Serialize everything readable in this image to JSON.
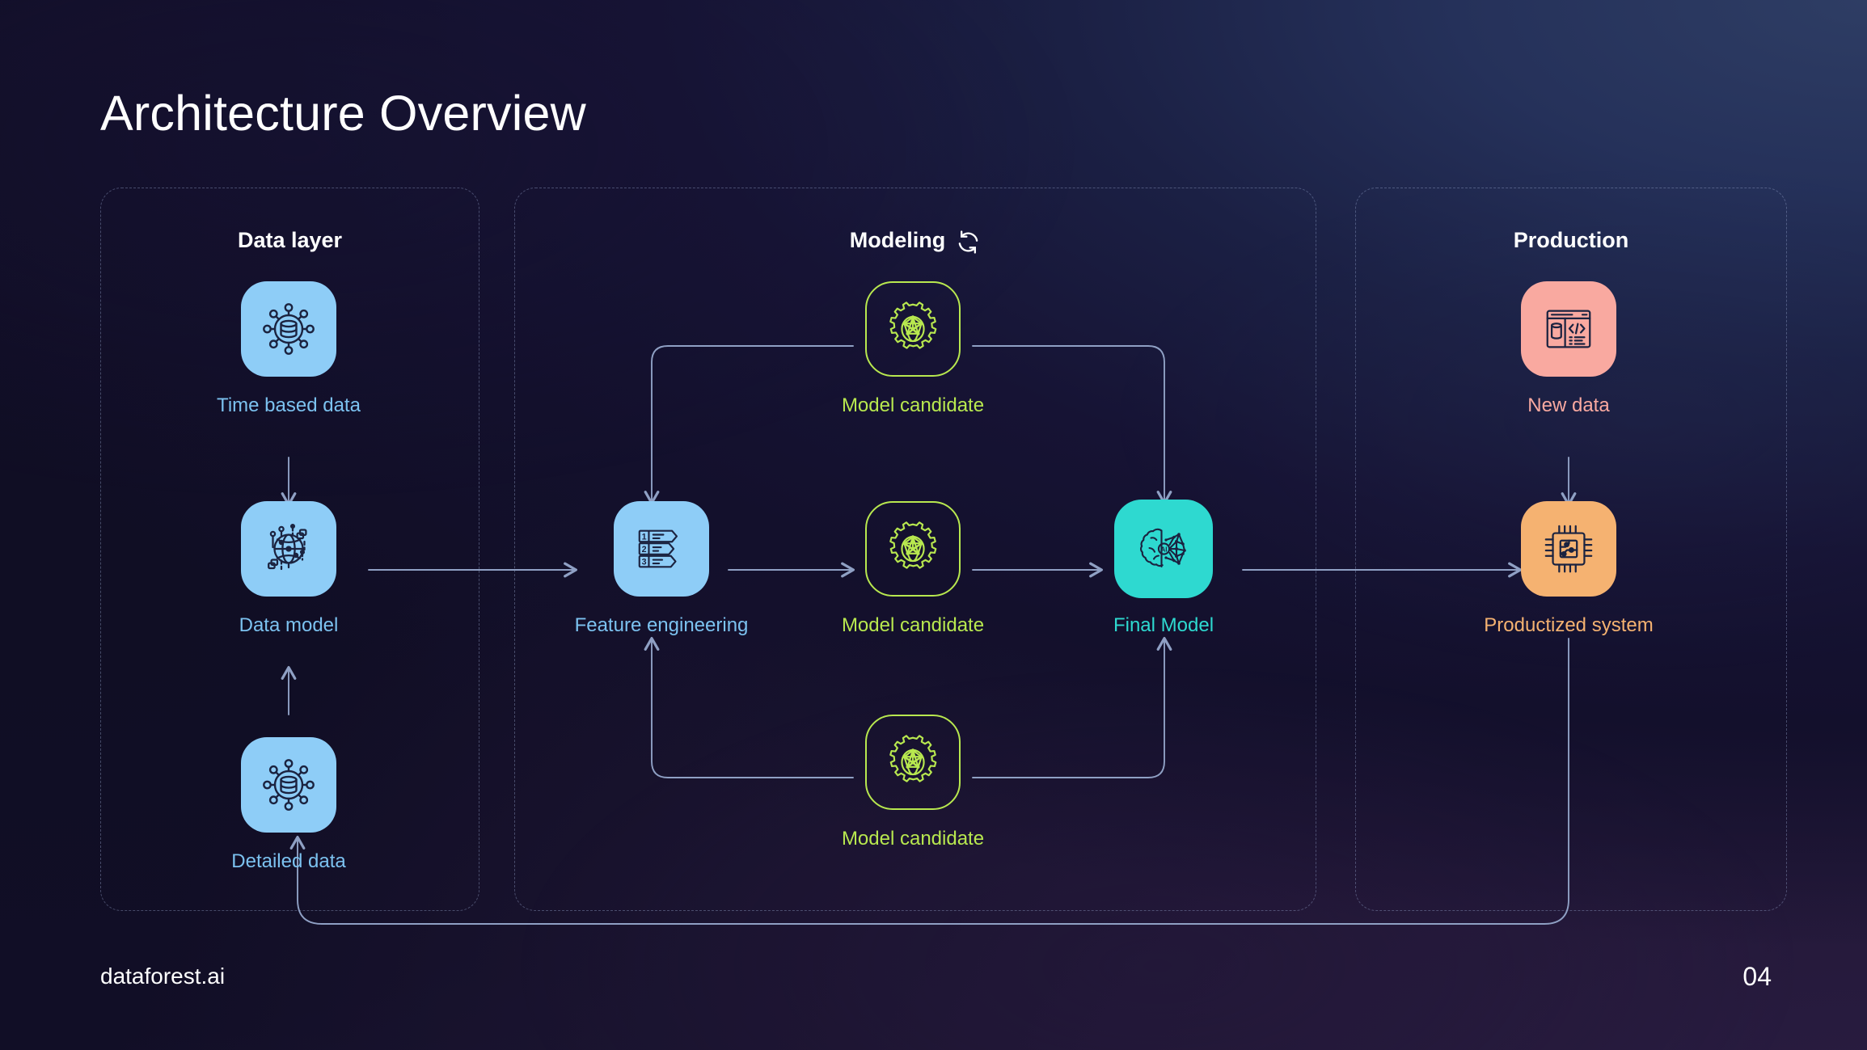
{
  "slide": {
    "title": "Architecture Overview",
    "page_number": "04",
    "brand": "dataforest.ai"
  },
  "colors": {
    "bg_top_right": "#2b3a60",
    "bg_bottom": "#1e1630",
    "bg_left": "#12102a",
    "blue_tile": "#8ecdf7",
    "blue_label": "#7cc2f0",
    "green_outline": "#b8e84f",
    "green_label": "#b8e84f",
    "teal_tile": "#2ed9d0",
    "teal_label": "#2ed9d0",
    "pink_tile": "#f9a9a0",
    "pink_label": "#f9a9a0",
    "orange_tile": "#f5b271",
    "orange_label": "#f5b271",
    "icon_stroke": "#1b2340",
    "connector": "#8fa0c4",
    "panel_border": "#96a6cd",
    "title_text": "#ffffff"
  },
  "panels": [
    {
      "id": "data-layer",
      "title": "Data layer",
      "has_sync_icon": false
    },
    {
      "id": "modeling",
      "title": "Modeling",
      "has_sync_icon": true,
      "sync_icon": "refresh-cycle-icon"
    },
    {
      "id": "production",
      "title": "Production",
      "has_sync_icon": false
    }
  ],
  "nodes": [
    {
      "id": "time-based-data",
      "label": "Time based data",
      "panel": "data-layer",
      "icon": "distributed-database-icon",
      "style": "blue-filled",
      "label_color": "#7cc2f0"
    },
    {
      "id": "data-model",
      "label": "Data model",
      "panel": "data-layer",
      "icon": "globe-network-icon",
      "style": "blue-filled",
      "label_color": "#7cc2f0"
    },
    {
      "id": "detailed-data",
      "label": "Detailed data",
      "panel": "data-layer",
      "icon": "distributed-database-icon",
      "style": "blue-filled",
      "label_color": "#7cc2f0"
    },
    {
      "id": "feature-engineering",
      "label": "Feature engineering",
      "panel": "modeling",
      "icon": "ranked-list-icon",
      "style": "blue-filled",
      "label_color": "#7cc2f0"
    },
    {
      "id": "model-candidate-top",
      "label": "Model candidate",
      "panel": "modeling",
      "icon": "gear-neural-network-icon",
      "style": "green-outline",
      "label_color": "#b8e84f"
    },
    {
      "id": "model-candidate-mid",
      "label": "Model candidate",
      "panel": "modeling",
      "icon": "gear-neural-network-icon",
      "style": "green-outline",
      "label_color": "#b8e84f"
    },
    {
      "id": "model-candidate-bot",
      "label": "Model candidate",
      "panel": "modeling",
      "icon": "gear-neural-network-icon",
      "style": "green-outline",
      "label_color": "#b8e84f"
    },
    {
      "id": "final-model",
      "label": "Final Model",
      "panel": "modeling",
      "icon": "ai-brain-icon",
      "style": "teal-filled",
      "label_color": "#2ed9d0"
    },
    {
      "id": "new-data",
      "label": "New data",
      "panel": "production",
      "icon": "browser-database-code-icon",
      "style": "pink-filled",
      "label_color": "#f9a9a0"
    },
    {
      "id": "productized-system",
      "label": "Productized system",
      "panel": "production",
      "icon": "cpu-chip-icon",
      "style": "orange-filled",
      "label_color": "#f5b271"
    }
  ],
  "connections": [
    {
      "from": "time-based-data",
      "to": "data-model",
      "type": "arrow-down"
    },
    {
      "from": "detailed-data",
      "to": "data-model",
      "type": "arrow-up"
    },
    {
      "from": "data-model",
      "to": "feature-engineering",
      "type": "arrow-right"
    },
    {
      "from": "feature-engineering",
      "to": "model-candidate-mid",
      "type": "arrow-right"
    },
    {
      "from": "model-candidate-mid",
      "to": "final-model",
      "type": "arrow-right"
    },
    {
      "from": "model-candidate-top",
      "to": "feature-engineering",
      "type": "elbow-down-left"
    },
    {
      "from": "model-candidate-top",
      "to": "final-model",
      "type": "elbow-down-right"
    },
    {
      "from": "model-candidate-bot",
      "to": "feature-engineering",
      "type": "elbow-up-left"
    },
    {
      "from": "model-candidate-bot",
      "to": "final-model",
      "type": "elbow-up-right"
    },
    {
      "from": "final-model",
      "to": "productized-system",
      "type": "arrow-right"
    },
    {
      "from": "new-data",
      "to": "productized-system",
      "type": "arrow-down"
    },
    {
      "from": "productized-system",
      "to": "detailed-data",
      "type": "feedback-loop-bottom"
    }
  ]
}
